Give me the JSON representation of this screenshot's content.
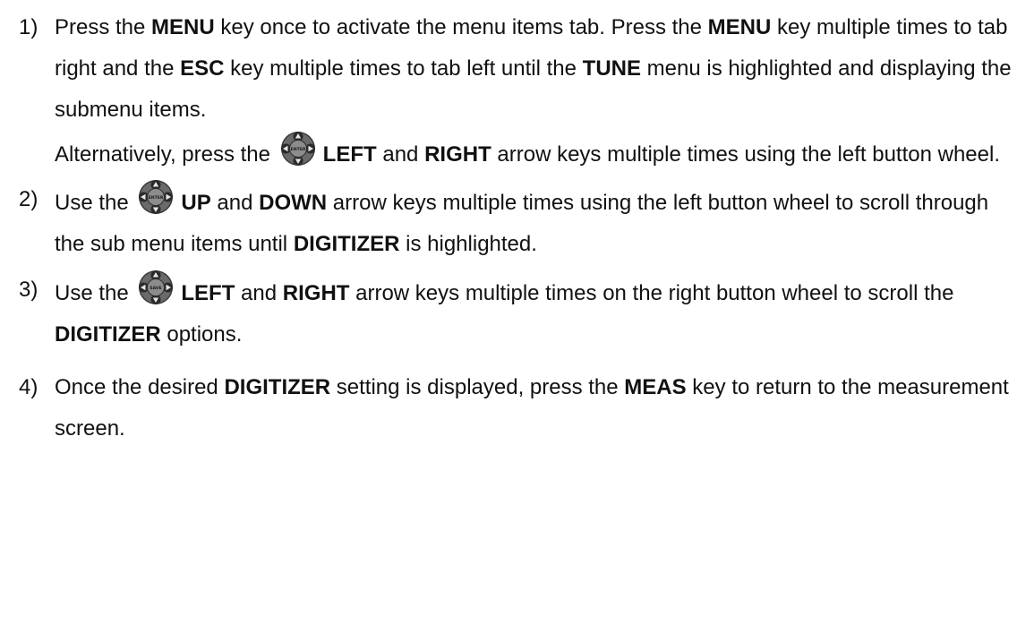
{
  "steps": [
    {
      "number": "1)",
      "segments": [
        {
          "t": "Press the "
        },
        {
          "t": "MENU",
          "b": true
        },
        {
          "t": " key once to activate the menu items tab.  Press the "
        },
        {
          "t": "MENU",
          "b": true
        },
        {
          "t": " key multiple times to tab right and the "
        },
        {
          "t": "ESC",
          "b": true
        },
        {
          "t": " key multiple times to tab left until the "
        },
        {
          "t": "TUNE",
          "b": true
        },
        {
          "t": " menu is highlighted and displaying the submenu items."
        },
        {
          "br": true
        },
        {
          "t": "Alternatively, press the "
        },
        {
          "icon": "left-button-wheel-icon",
          "label": "ENTER"
        },
        {
          "t": "LEFT",
          "b": true
        },
        {
          "t": " and "
        },
        {
          "t": "RIGHT",
          "b": true
        },
        {
          "t": " arrow keys multiple times using the left button wheel."
        }
      ]
    },
    {
      "number": "2)",
      "segments": [
        {
          "t": "Use the "
        },
        {
          "icon": "left-button-wheel-icon",
          "label": "ENTER"
        },
        {
          "t": "UP",
          "b": true
        },
        {
          "t": " and "
        },
        {
          "t": "DOWN",
          "b": true
        },
        {
          "t": " arrow keys multiple times using the left button wheel to scroll through the sub menu items until "
        },
        {
          "t": "DIGITIZER",
          "b": true
        },
        {
          "t": " is highlighted."
        }
      ]
    },
    {
      "number": "3)",
      "segments": [
        {
          "t": "Use the "
        },
        {
          "icon": "right-button-wheel-icon",
          "label": "SAVE"
        },
        {
          "t": "LEFT",
          "b": true
        },
        {
          "t": " and "
        },
        {
          "t": "RIGHT",
          "b": true
        },
        {
          "t": " arrow keys multiple times on the right button wheel to scroll the "
        },
        {
          "t": "DIGITIZER",
          "b": true
        },
        {
          "t": " options."
        }
      ]
    },
    {
      "number": "4)",
      "segments": [
        {
          "t": "Once the desired "
        },
        {
          "t": "DIGITIZER",
          "b": true
        },
        {
          "t": " setting is displayed, press the "
        },
        {
          "t": "MEAS",
          "b": true
        },
        {
          "t": " key to return to the measurement screen."
        }
      ]
    }
  ]
}
